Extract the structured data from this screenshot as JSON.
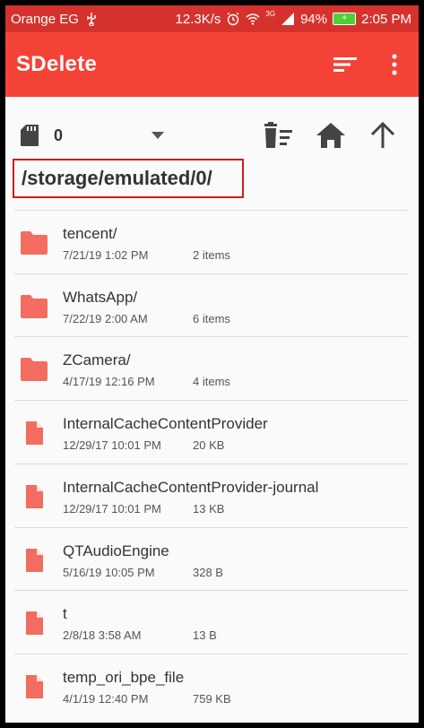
{
  "status_bar": {
    "carrier": "Orange EG",
    "speed": "12.3K/s",
    "network": "3G",
    "battery": "94%",
    "time": "2:05 PM"
  },
  "app_bar": {
    "title": "SDelete",
    "sort_icon": "sort-icon",
    "more_icon": "more-vert-icon"
  },
  "toolbar": {
    "storage_icon": "sd-card-icon",
    "selected_count": "0",
    "dropdown_icon": "arrow-drop-down-icon",
    "clear_icon": "delete-sweep-icon",
    "home_icon": "home-icon",
    "up_icon": "arrow-upward-icon"
  },
  "path": "/storage/emulated/0/",
  "colors": {
    "status_bar": "#d6322d",
    "app_bar": "#f44336",
    "path_border": "#cc1f1f",
    "icon_folder": "#f26d60",
    "icon_file": "#f26d60"
  },
  "files": [
    {
      "type": "folder",
      "name": "tencent/",
      "date": "7/21/19  1:02 PM",
      "meta": "2 items"
    },
    {
      "type": "folder",
      "name": "WhatsApp/",
      "date": "7/22/19  2:00 AM",
      "meta": "6 items"
    },
    {
      "type": "folder",
      "name": "ZCamera/",
      "date": "4/17/19  12:16 PM",
      "meta": "4 items"
    },
    {
      "type": "file",
      "name": "InternalCacheContentProvider",
      "date": "12/29/17  10:01 PM",
      "meta": "20 KB"
    },
    {
      "type": "file",
      "name": "InternalCacheContentProvider-journal",
      "date": "12/29/17  10:01 PM",
      "meta": "13 KB"
    },
    {
      "type": "file",
      "name": "QTAudioEngine",
      "date": "5/16/19  10:05 PM",
      "meta": "328 B"
    },
    {
      "type": "file",
      "name": "t",
      "date": "2/8/18  3:58 AM",
      "meta": "13 B"
    },
    {
      "type": "file",
      "name": "temp_ori_bpe_file",
      "date": "4/1/19  12:40 PM",
      "meta": "759 KB"
    }
  ]
}
